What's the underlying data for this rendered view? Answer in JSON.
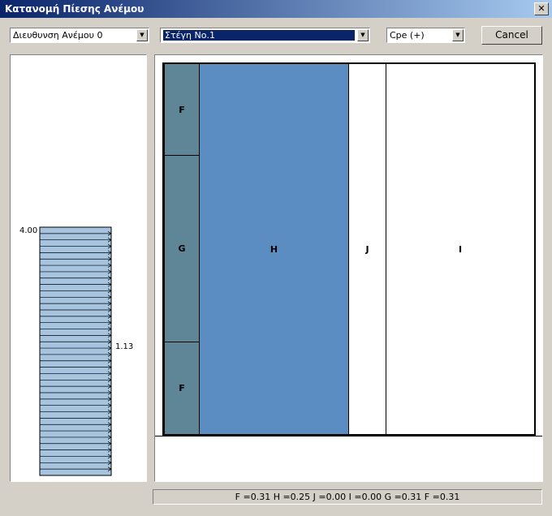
{
  "window": {
    "title": "Κατανομή Πίεσης Ανέμου",
    "close": "✕"
  },
  "toolbar": {
    "direction": "Διευθυνση Ανέμου 0",
    "roof": "Στέγη Νο.1",
    "cpe": "Cpe (+)",
    "cancel": "Cancel"
  },
  "profile": {
    "top_label": "4.00",
    "mid_label": "1.13",
    "fill_color": "#a6c4e0",
    "arrow_count": 38
  },
  "zones": {
    "F_top": "F",
    "G": "G",
    "F_bottom": "F",
    "H": "H",
    "J": "J",
    "I": "I"
  },
  "colors": {
    "F": "#5f8696",
    "G": "#5f8696",
    "H": "#5b8dc2",
    "J": "#ffffff",
    "I": "#ffffff"
  },
  "status": "F =0.31 H =0.25 J =0.00 I =0.00 G =0.31 F =0.31"
}
